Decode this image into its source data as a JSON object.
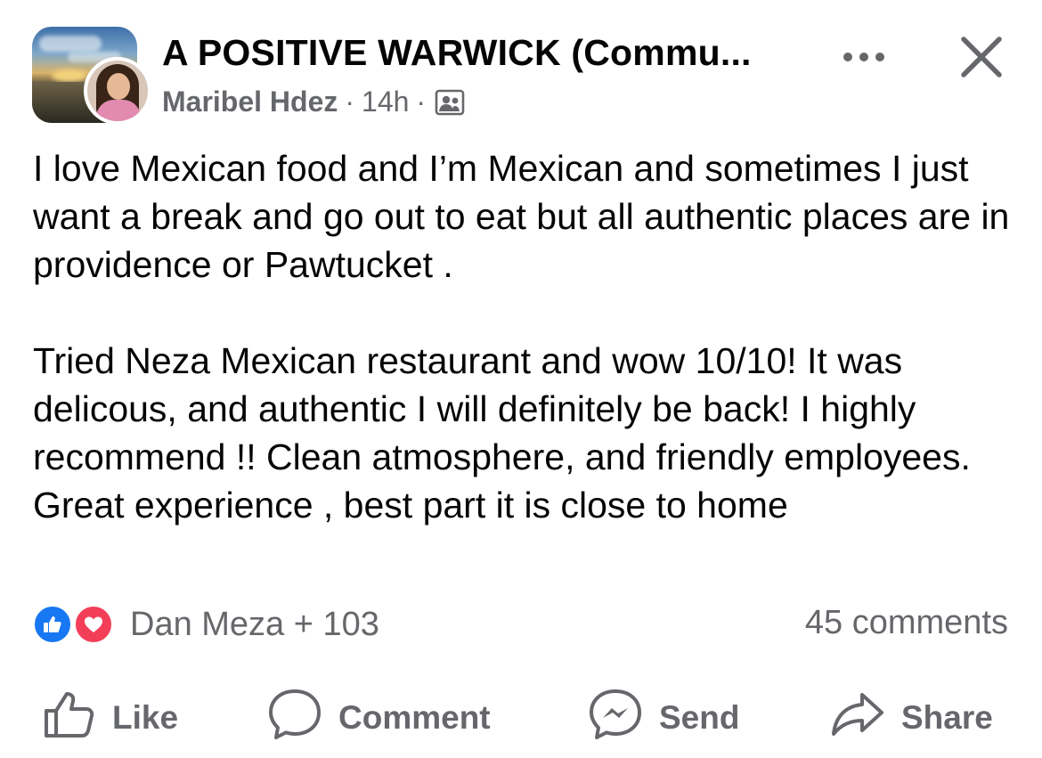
{
  "header": {
    "group_name": "A POSITIVE WARWICK (Commu...",
    "author": "Maribel Hdez",
    "time": "14h",
    "separator": "·",
    "audience_icon": "group-members-icon",
    "more_icon": "more-options-icon",
    "close_icon": "close-icon"
  },
  "post": {
    "paragraphs": [
      "I love Mexican food and I’m Mexican and sometimes I just want a break and go out to eat but all authentic places are in providence or Pawtucket .",
      "Tried Neza Mexican restaurant and wow 10/10! It was delicous, and authentic I will definitely be back! I highly recommend !! Clean atmosphere, and friendly employees. Great experience , best part it is close to home"
    ]
  },
  "engagement": {
    "reaction_icons": [
      "like-reaction-icon",
      "love-reaction-icon"
    ],
    "reactors": "Dan Meza + 103",
    "comments": "45 comments"
  },
  "actions": {
    "like": "Like",
    "comment": "Comment",
    "send": "Send",
    "share": "Share"
  },
  "colors": {
    "text_primary": "#050505",
    "text_secondary": "#65676b",
    "like_blue": "#1877f2",
    "love_red": "#f33e58"
  }
}
